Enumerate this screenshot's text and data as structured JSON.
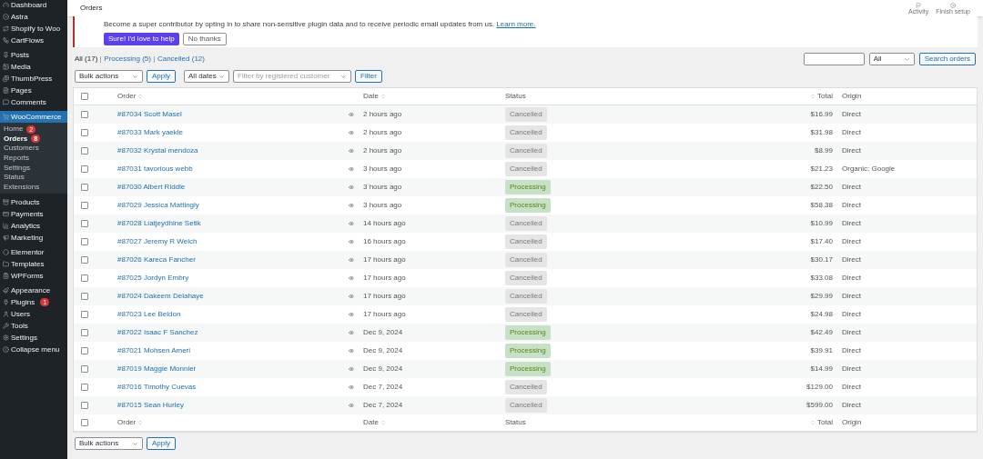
{
  "sidebar": {
    "groups": [
      [
        {
          "label": "Dashboard",
          "selected": false
        },
        {
          "label": "Astra",
          "selected": false
        },
        {
          "label": "Shopify to Woo",
          "selected": false
        },
        {
          "label": "CartFlows",
          "selected": false
        }
      ],
      [
        {
          "label": "Posts",
          "selected": false
        },
        {
          "label": "Media",
          "selected": false
        },
        {
          "label": "ThumbPress",
          "selected": false
        },
        {
          "label": "Pages",
          "selected": false
        },
        {
          "label": "Comments",
          "selected": false
        }
      ],
      [
        {
          "label": "WooCommerce",
          "selected": true,
          "children": [
            {
              "label": "Home",
              "selected": false,
              "badge": "2"
            },
            {
              "label": "Orders",
              "selected": true,
              "badge": "8"
            },
            {
              "label": "Customers",
              "selected": false
            },
            {
              "label": "Reports",
              "selected": false
            },
            {
              "label": "Settings",
              "selected": false
            },
            {
              "label": "Status",
              "selected": false
            },
            {
              "label": "Extensions",
              "selected": false
            }
          ]
        }
      ],
      [
        {
          "label": "Products",
          "selected": false
        },
        {
          "label": "Payments",
          "selected": false
        },
        {
          "label": "Analytics",
          "selected": false
        },
        {
          "label": "Marketing",
          "selected": false
        }
      ],
      [
        {
          "label": "Elementor",
          "selected": false
        },
        {
          "label": "Templates",
          "selected": false
        },
        {
          "label": "WPForms",
          "selected": false
        }
      ],
      [
        {
          "label": "Appearance",
          "selected": false
        },
        {
          "label": "Plugins",
          "selected": false,
          "badge": "1"
        },
        {
          "label": "Users",
          "selected": false
        },
        {
          "label": "Tools",
          "selected": false
        },
        {
          "label": "Settings",
          "selected": false
        },
        {
          "label": "Collapse menu",
          "selected": false
        }
      ]
    ]
  },
  "topbar": {
    "title": "Orders",
    "actions": [
      "Activity",
      "Finish setup"
    ]
  },
  "notice": {
    "text": "Become a super contributor by opting in to share non-sensitive plugin data and to receive periodic email updates from us.",
    "link": "Learn more.",
    "buttons": [
      {
        "label": "Sure! I'd love to help",
        "kind": "primary"
      },
      {
        "label": "No thanks",
        "kind": "secondary"
      }
    ]
  },
  "views": [
    {
      "label": "All (17)",
      "selected": true
    },
    {
      "label": "Processing (5)",
      "selected": false
    },
    {
      "label": "Cancelled (12)",
      "selected": false
    }
  ],
  "search": {
    "status": "All",
    "button": "Search orders"
  },
  "toolbar": {
    "bulk": "Bulk actions",
    "apply": "Apply",
    "dates": "All dates",
    "customer_placeholder": "Filter by registered customer",
    "filter": "Filter"
  },
  "table": {
    "select_all_checked": false,
    "columns": [
      "Order",
      "Date",
      "Status",
      "Total",
      "Origin"
    ],
    "rows": [
      {
        "checked": false,
        "order": "#87034 Scott Masel",
        "date": "2 hours ago",
        "status": "Cancelled",
        "kind": "cancelled",
        "total": "$16.99",
        "origin": "Direct"
      },
      {
        "checked": false,
        "order": "#87033 Mark yaekle",
        "date": "2 hours ago",
        "status": "Cancelled",
        "kind": "cancelled",
        "total": "$31.98",
        "origin": "Direct"
      },
      {
        "checked": false,
        "order": "#87032 Krystal mendoza",
        "date": "2 hours ago",
        "status": "Cancelled",
        "kind": "cancelled",
        "total": "$8.99",
        "origin": "Direct"
      },
      {
        "checked": false,
        "order": "#87031 tavorious webb",
        "date": "3 hours ago",
        "status": "Cancelled",
        "kind": "cancelled",
        "total": "$21.23",
        "origin": "Organic: Google"
      },
      {
        "checked": false,
        "order": "#87030 Albert Riddle",
        "date": "3 hours ago",
        "status": "Processing",
        "kind": "processing",
        "total": "$22.50",
        "origin": "Direct"
      },
      {
        "checked": false,
        "order": "#87029 Jessica Mattingly",
        "date": "3 hours ago",
        "status": "Processing",
        "kind": "processing",
        "total": "$58.38",
        "origin": "Direct"
      },
      {
        "checked": false,
        "order": "#87028 Liatjeydhine Setik",
        "date": "14 hours ago",
        "status": "Cancelled",
        "kind": "cancelled",
        "total": "$10.99",
        "origin": "Direct"
      },
      {
        "checked": false,
        "order": "#87027 Jeremy R Welch",
        "date": "16 hours ago",
        "status": "Cancelled",
        "kind": "cancelled",
        "total": "$17.40",
        "origin": "Direct"
      },
      {
        "checked": false,
        "order": "#87026 Kareca Fancher",
        "date": "17 hours ago",
        "status": "Cancelled",
        "kind": "cancelled",
        "total": "$30.17",
        "origin": "Direct"
      },
      {
        "checked": false,
        "order": "#87025 Jordyn Embry",
        "date": "17 hours ago",
        "status": "Cancelled",
        "kind": "cancelled",
        "total": "$33.08",
        "origin": "Direct"
      },
      {
        "checked": false,
        "order": "#87024 Dakeem Delahaye",
        "date": "17 hours ago",
        "status": "Cancelled",
        "kind": "cancelled",
        "total": "$29.99",
        "origin": "Direct"
      },
      {
        "checked": false,
        "order": "#87023 Lee Beldon",
        "date": "17 hours ago",
        "status": "Cancelled",
        "kind": "cancelled",
        "total": "$24.98",
        "origin": "Direct"
      },
      {
        "checked": false,
        "order": "#87022 Isaac F Sanchez",
        "date": "Dec 9, 2024",
        "status": "Processing",
        "kind": "processing",
        "total": "$42.49",
        "origin": "Direct"
      },
      {
        "checked": false,
        "order": "#87021 Mohsen Ameri",
        "date": "Dec 9, 2024",
        "status": "Processing",
        "kind": "processing",
        "total": "$39.91",
        "origin": "Direct"
      },
      {
        "checked": false,
        "order": "#87019 Maggie Monnier",
        "date": "Dec 9, 2024",
        "status": "Processing",
        "kind": "processing",
        "total": "$14.99",
        "origin": "Direct"
      },
      {
        "checked": false,
        "order": "#87016 Timothy Cuevas",
        "date": "Dec 7, 2024",
        "status": "Cancelled",
        "kind": "cancelled",
        "total": "$129.00",
        "origin": "Direct"
      },
      {
        "checked": false,
        "order": "#87015 Sean Hurley",
        "date": "Dec 7, 2024",
        "status": "Cancelled",
        "kind": "cancelled",
        "total": "$599.00",
        "origin": "Direct"
      }
    ],
    "footer_columns": [
      "Order",
      "Date",
      "Status",
      "Total",
      "Origin"
    ]
  },
  "bottom_toolbar": {
    "bulk": "Bulk actions",
    "apply": "Apply"
  }
}
